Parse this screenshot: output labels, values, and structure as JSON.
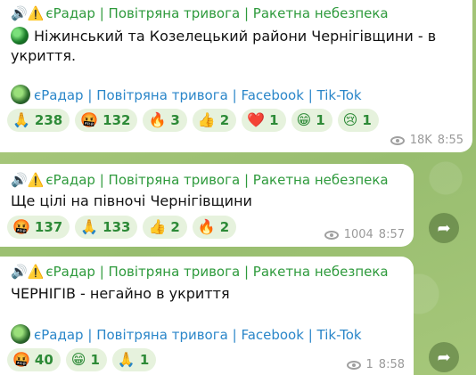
{
  "messages": [
    {
      "header": {
        "icons": "🔊⚠️",
        "channel": "єРадар",
        "sep": "|",
        "alert": "Повітряна тривога",
        "sep2": "|",
        "danger": "Ракетна небезпека"
      },
      "body_line1": "Ніжинський та Козелецький райони Чернігівщини - в",
      "body_line2": "укриття.",
      "links": {
        "channel": "єРадар",
        "sep": "|",
        "alert": "Повітряна тривога",
        "sep2": "|",
        "facebook": "Facebook",
        "sep3": "|",
        "tiktok": "Tik-Tok"
      },
      "reactions": [
        {
          "emoji": "🙏",
          "count": "238"
        },
        {
          "emoji": "🤬",
          "count": "132"
        },
        {
          "emoji": "🔥",
          "count": "3"
        },
        {
          "emoji": "👍",
          "count": "2"
        },
        {
          "emoji": "❤️",
          "count": "1"
        },
        {
          "emoji": "😁",
          "count": "1"
        },
        {
          "emoji": "😢",
          "count": "1"
        }
      ],
      "views": "18K",
      "time": "8:55"
    },
    {
      "header": {
        "icons": "🔊⚠️",
        "channel": "єРадар",
        "sep": "|",
        "alert": "Повітряна тривога",
        "sep2": "|",
        "danger": "Ракетна небезпека"
      },
      "body_line1": "Ще цілі на півночі Чернігівщини",
      "reactions": [
        {
          "emoji": "🤬",
          "count": "137"
        },
        {
          "emoji": "🙏",
          "count": "133"
        },
        {
          "emoji": "👍",
          "count": "2"
        },
        {
          "emoji": "🔥",
          "count": "2"
        }
      ],
      "views": "1004",
      "time": "8:57"
    },
    {
      "header": {
        "icons": "🔊⚠️",
        "channel": "єРадар",
        "sep": "|",
        "alert": "Повітряна тривога",
        "sep2": "|",
        "danger": "Ракетна небезпека"
      },
      "body_line1": "ЧЕРНІГІВ - негайно в укриття",
      "links": {
        "channel": "єРадар",
        "sep": "|",
        "alert": "Повітряна тривога",
        "sep2": "|",
        "facebook": "Facebook",
        "sep3": "|",
        "tiktok": "Tik-Tok"
      },
      "reactions": [
        {
          "emoji": "🤬",
          "count": "40"
        },
        {
          "emoji": "😁",
          "count": "1"
        },
        {
          "emoji": "🙏",
          "count": "1"
        }
      ],
      "views": "1",
      "time": "8:58"
    }
  ],
  "share_icon": "➦"
}
